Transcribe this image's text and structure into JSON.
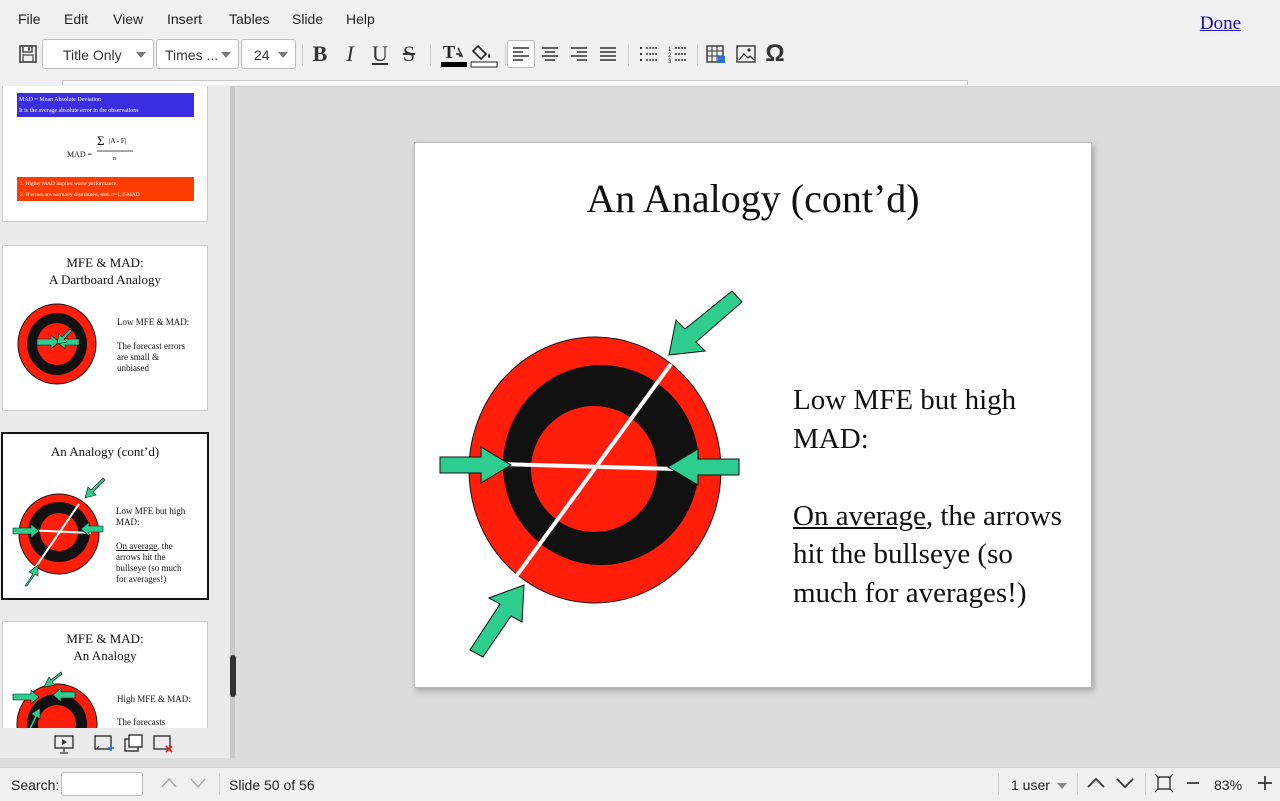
{
  "menu": {
    "items": [
      "File",
      "Edit",
      "View",
      "Insert",
      "Tables",
      "Slide",
      "Help"
    ],
    "done": "Done"
  },
  "toolbar": {
    "layout": "Title Only",
    "font": "Times ...",
    "size": "24",
    "bold": "B",
    "italic": "I",
    "underline": "U",
    "strike": "S",
    "omega": "Ω"
  },
  "thumbnails": {
    "t1": {
      "line1": "MAD = Mean Absolute Deviation",
      "line2": "It is the average absolute error in the observations",
      "formula": "MAD =",
      "bullet1": "1. Higher MAD implies worse performance.",
      "bullet2": "2. If errors are normally distributed, then σ=1.25MAD"
    },
    "t2": {
      "title1": "MFE & MAD:",
      "title2": "A Dartboard Analogy",
      "body1": "Low MFE & MAD:",
      "body2": "The forecast errors are small & unbiased"
    },
    "t3": {
      "title": "An Analogy (cont’d)",
      "body1": "Low MFE but high MAD:",
      "body2u": "On average",
      "body2": ", the arrows hit the bullseye (so much for averages!)"
    },
    "t4": {
      "title1": "MFE & MAD:",
      "title2": "An Analogy",
      "body1": "High MFE & MAD:",
      "body2": "The forecasts"
    }
  },
  "slide": {
    "title": "An Analogy (cont’d)",
    "line1": "Low MFE but high MAD:",
    "underlined": "On average",
    "rest": ", the arrows hit the bullseye (so much for averages!)"
  },
  "status": {
    "search_label": "Search:",
    "slide_indicator": "Slide 50 of 56",
    "users": "1 user",
    "zoom": "83%"
  },
  "colors": {
    "target_red": "#ff1e0a",
    "arrow_green": "#2ecc8e",
    "blue_box": "#3a2ee0",
    "orange_box": "#ff3c00"
  }
}
